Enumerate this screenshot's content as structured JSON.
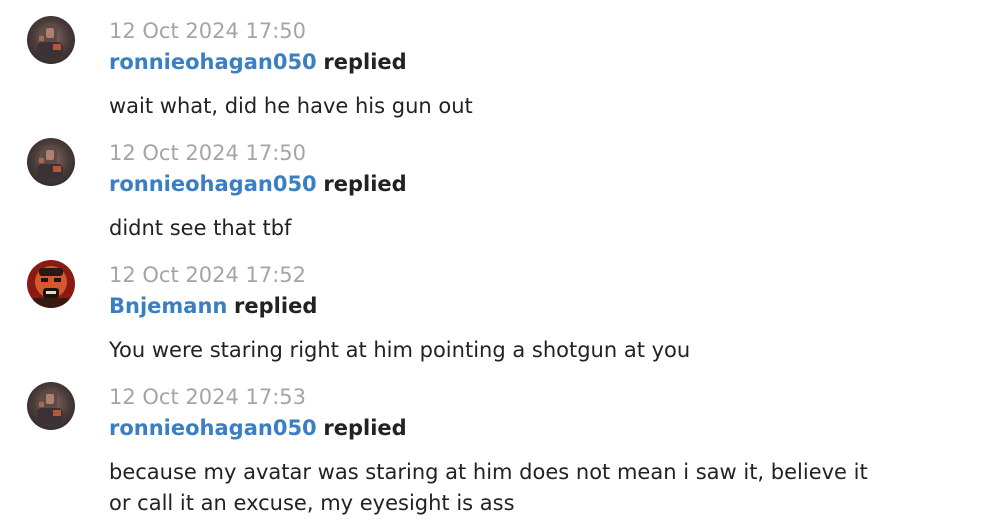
{
  "comments": [
    {
      "avatar": "ronnieohagan050-avatar",
      "timestamp": "12 Oct 2024 17:50",
      "username": "ronnieohagan050",
      "action": "replied",
      "text": "wait what, did he have his gun out"
    },
    {
      "avatar": "ronnieohagan050-avatar",
      "timestamp": "12 Oct 2024 17:50",
      "username": "ronnieohagan050",
      "action": "replied",
      "text": "didnt see that tbf"
    },
    {
      "avatar": "bnjemann-avatar",
      "timestamp": "12 Oct 2024 17:52",
      "username": "Bnjemann",
      "action": "replied",
      "text": "You were staring right at him pointing a shotgun at you"
    },
    {
      "avatar": "ronnieohagan050-avatar",
      "timestamp": "12 Oct 2024 17:53",
      "username": "ronnieohagan050",
      "action": "replied",
      "text": "because my avatar was staring at him does not mean i saw it, believe it or call it an excuse, my eyesight is ass"
    }
  ],
  "colors": {
    "username": "#3a7fc1",
    "timestamp": "#a5a5a5",
    "text": "#222222"
  }
}
